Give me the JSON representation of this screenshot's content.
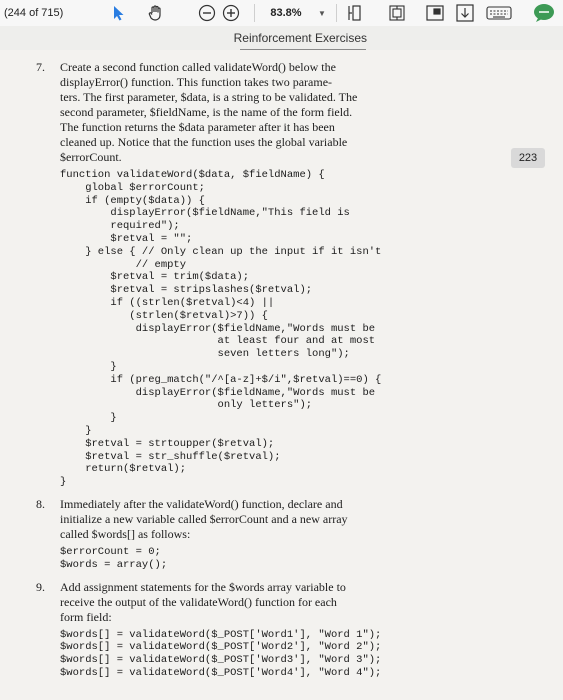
{
  "toolbar": {
    "page_info": "(244 of 715)",
    "zoom": "83.8%",
    "icons": [
      "pointer-icon",
      "hand-icon",
      "zoom-out-icon",
      "zoom-in-icon",
      "zoom-dropdown-icon",
      "fit-width-icon",
      "fit-page-icon",
      "thumbnail-icon",
      "download-icon",
      "keyboard-icon",
      "comment-icon"
    ]
  },
  "section": {
    "title": "Reinforcement Exercises"
  },
  "page_number": "223",
  "exercises": [
    {
      "num": "7.",
      "lines": [
        "Create a second function called validateWord() below the",
        "displayError() function. This function takes two parame-",
        "ters. The first parameter, $data, is a string to be validated. The",
        "second parameter, $fieldName, is the name of the form field.",
        "The function returns the $data parameter after it has been",
        "cleaned up. Notice that the function uses the global variable",
        "$errorCount."
      ],
      "code": "function validateWord($data, $fieldName) {\n    global $errorCount;\n    if (empty($data)) {\n        displayError($fieldName,\"This field is\n        required\");\n        $retval = \"\";\n    } else { // Only clean up the input if it isn't\n            // empty\n        $retval = trim($data);\n        $retval = stripslashes($retval);\n        if ((strlen($retval)<4) ||\n           (strlen($retval)>7)) {\n            displayError($fieldName,\"Words must be\n                         at least four and at most\n                         seven letters long\");\n        }\n        if (preg_match(\"/^[a-z]+$/i\",$retval)==0) {\n            displayError($fieldName,\"Words must be\n                         only letters\");\n        }\n    }\n    $retval = strtoupper($retval);\n    $retval = str_shuffle($retval);\n    return($retval);\n}"
    },
    {
      "num": "8.",
      "lines": [
        "Immediately after the validateWord() function, declare and",
        "initialize a new variable called $errorCount and a new array",
        "called $words[] as follows:"
      ],
      "code": "$errorCount = 0;\n$words = array();"
    },
    {
      "num": "9.",
      "lines": [
        "Add assignment statements for the $words array variable to",
        "receive the output of the validateWord() function for each",
        "form field:"
      ],
      "code": "$words[] = validateWord($_POST['Word1'], \"Word 1\");\n$words[] = validateWord($_POST['Word2'], \"Word 2\");\n$words[] = validateWord($_POST['Word3'], \"Word 3\");\n$words[] = validateWord($_POST['Word4'], \"Word 4\");"
    }
  ]
}
